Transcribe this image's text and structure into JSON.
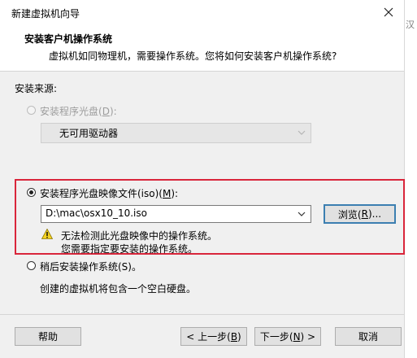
{
  "window": {
    "title": "新建虚拟机向导"
  },
  "header": {
    "title": "安装客户机操作系统",
    "subtitle": "虚拟机如同物理机，需要操作系统。您将如何安装客户机操作系统?"
  },
  "source_label": "安装来源:",
  "option_disc": {
    "label_pre": "安装程序光盘(",
    "key": "D",
    "label_post": "):",
    "drive_value": "无可用驱动器",
    "selected": false,
    "enabled": false
  },
  "option_iso": {
    "label_pre": "安装程序光盘映像文件(iso)(",
    "key": "M",
    "label_post": "):",
    "path_value": "D:\\mac\\osx10_10.iso",
    "selected": true,
    "browse_pre": "浏览(",
    "browse_key": "R",
    "browse_post": ")...",
    "warning_line1": "无法检测此光盘映像中的操作系统。",
    "warning_line2": "您需要指定要安装的操作系统。"
  },
  "option_later": {
    "label": "稍后安装操作系统(S)。",
    "selected": false,
    "description": "创建的虚拟机将包含一个空白硬盘。"
  },
  "footer": {
    "help": "帮助",
    "back_pre": "< 上一步(",
    "back_key": "B",
    "back_post": ")",
    "next_pre": "下一步(",
    "next_key": "N",
    "next_post": ") >",
    "cancel": "取消"
  },
  "side_fragment": "汉",
  "colors": {
    "highlight_border": "#d9263b",
    "default_button_border": "#3c7fb1",
    "warning_yellow": "#f5d322"
  }
}
